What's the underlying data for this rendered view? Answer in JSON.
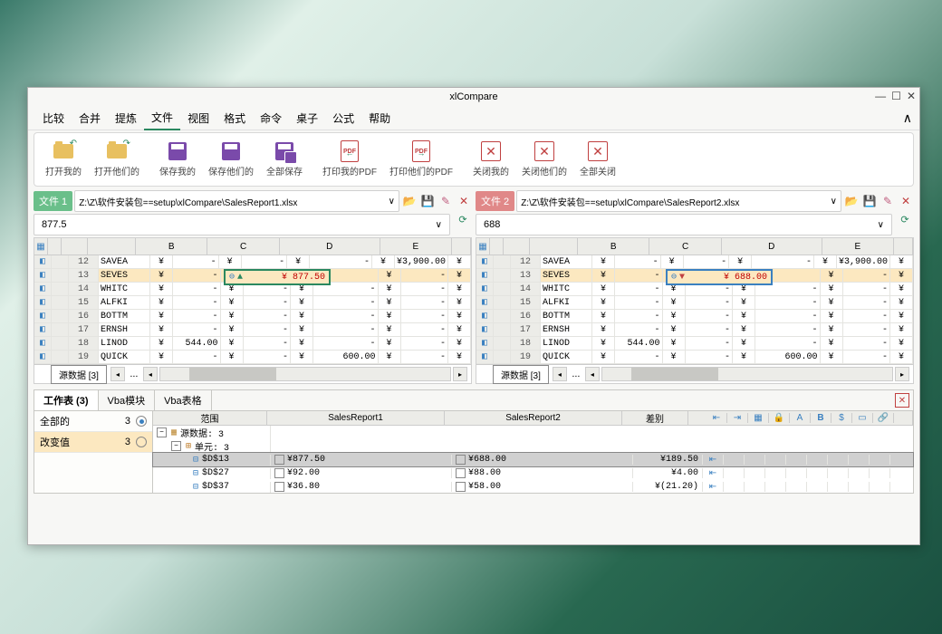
{
  "title": "xlCompare",
  "menu": [
    "比较",
    "合并",
    "提炼",
    "文件",
    "视图",
    "格式",
    "命令",
    "桌子",
    "公式",
    "帮助"
  ],
  "menu_active_index": 3,
  "toolbar": {
    "open_mine": "打开我的",
    "open_theirs": "打开他们的",
    "save_mine": "保存我的",
    "save_theirs": "保存他们的",
    "save_all": "全部保存",
    "print_mine_pdf": "打印我的PDF",
    "print_theirs_pdf": "打印他们的PDF",
    "close_mine": "关闭我的",
    "close_theirs": "关闭他们的",
    "close_all": "全部关闭"
  },
  "file1": {
    "tag": "文件 1",
    "path": "Z:\\Z\\软件安装包==setup\\xlCompare\\SalesReport1.xlsx",
    "value": "877.5",
    "diff_cell_value": "¥    877.50",
    "sheet_tab": "源数据 [3]"
  },
  "file2": {
    "tag": "文件 2",
    "path": "Z:\\Z\\软件安装包==setup\\xlCompare\\SalesReport2.xlsx",
    "value": "688",
    "diff_cell_value": "¥    688.00",
    "sheet_tab": "源数据 [3]"
  },
  "grid": {
    "cols": [
      "B",
      "C",
      "D",
      "E"
    ],
    "rows": [
      {
        "n": "12",
        "a": "SAVEA",
        "b": "-",
        "c": "-",
        "d": "-",
        "e": "¥3,900.00"
      },
      {
        "n": "13",
        "a": "SEVES",
        "b": "-",
        "c": "-",
        "d": "",
        "e": "-",
        "hl": true
      },
      {
        "n": "14",
        "a": "WHITC",
        "b": "-",
        "c": "-",
        "d": "-",
        "e": "-"
      },
      {
        "n": "15",
        "a": "ALFKI",
        "b": "-",
        "c": "-",
        "d": "-",
        "e": "-"
      },
      {
        "n": "16",
        "a": "BOTTM",
        "b": "-",
        "c": "-",
        "d": "-",
        "e": "-"
      },
      {
        "n": "17",
        "a": "ERNSH",
        "b": "-",
        "c": "-",
        "d": "-",
        "e": "-"
      },
      {
        "n": "18",
        "a": "LINOD",
        "b": "544.00",
        "c": "-",
        "d": "-",
        "e": "-"
      },
      {
        "n": "19",
        "a": "QUICK",
        "b": "-",
        "c": "-",
        "d": "600.00",
        "e": "-"
      }
    ]
  },
  "bottom": {
    "tabs": [
      "工作表 (3)",
      "Vba模块",
      "Vba表格"
    ],
    "filter_all": "全部的",
    "filter_all_count": "3",
    "filter_changed": "改变值",
    "filter_changed_count": "3",
    "header_range": "范围",
    "header_r1": "SalesReport1",
    "header_r2": "SalesReport2",
    "header_diff": "差别",
    "tree_root": "源数据: 3",
    "tree_unit": "单元: 3",
    "rows": [
      {
        "ref": "$D$13",
        "v1": "¥877.50",
        "v2": "¥688.00",
        "diff": "¥189.50",
        "sel": true
      },
      {
        "ref": "$D$27",
        "v1": "¥92.00",
        "v2": "¥88.00",
        "diff": "¥4.00"
      },
      {
        "ref": "$D$37",
        "v1": "¥36.80",
        "v2": "¥58.00",
        "diff": "¥(21.20)"
      }
    ]
  }
}
